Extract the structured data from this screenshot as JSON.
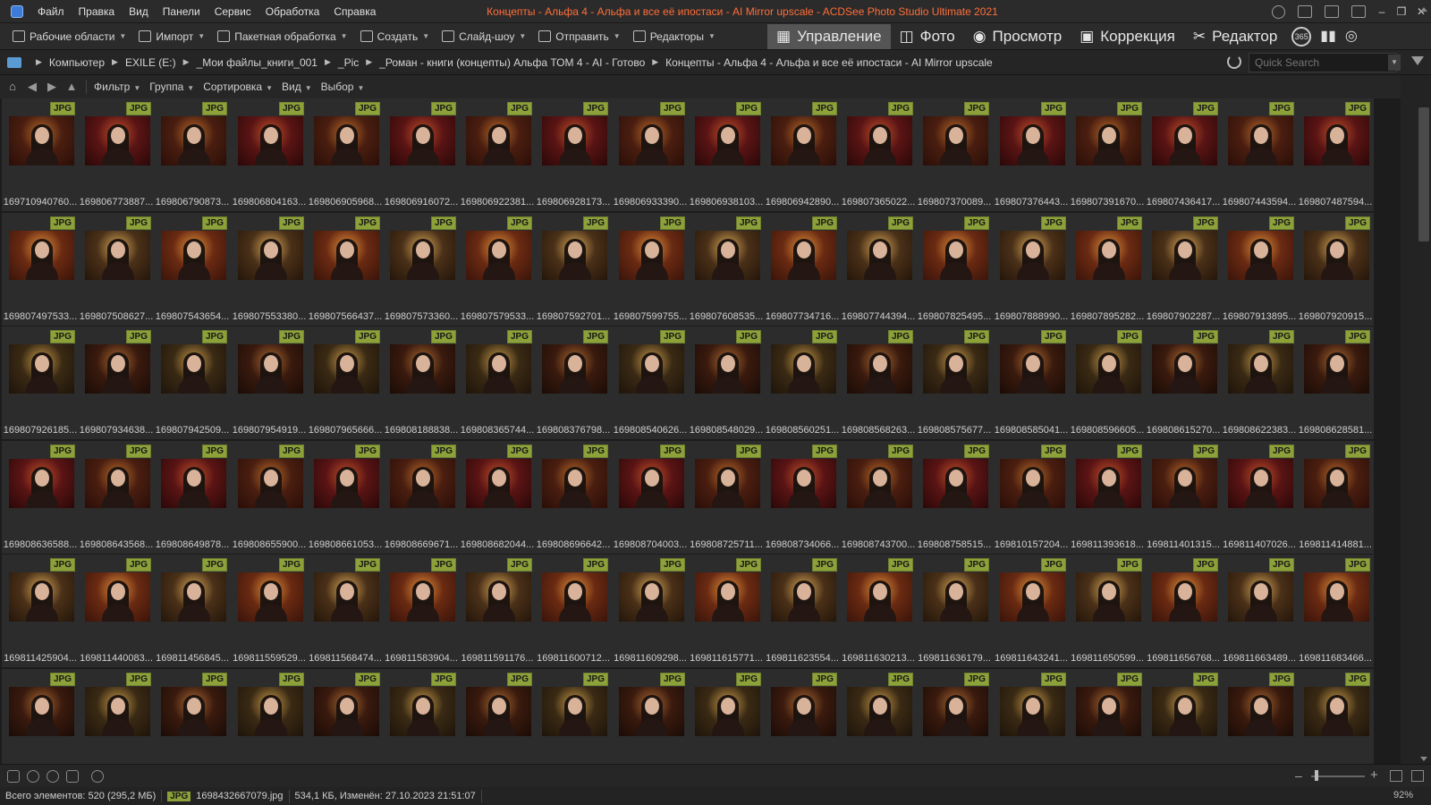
{
  "window": {
    "title": "Концепты - Альфа 4 - Альфа и все её ипостаси - AI Mirror upscale - ACDSee Photo Studio Ultimate 2021",
    "menu": [
      "Файл",
      "Правка",
      "Вид",
      "Панели",
      "Сервис",
      "Обработка",
      "Справка"
    ]
  },
  "toolbar": {
    "items": [
      "Рабочие области",
      "Импорт",
      "Пакетная обработка",
      "Создать",
      "Слайд-шоу",
      "Отправить",
      "Редакторы"
    ],
    "modes": [
      "Управление",
      "Фото",
      "Просмотр",
      "Коррекция",
      "Редактор"
    ],
    "active_mode": "Управление",
    "mode_365": "365"
  },
  "addressbar": {
    "crumbs": [
      "Компьютер",
      "EXILE (E:)",
      "_Мои файлы_книги_001",
      "_Pic",
      "_Роман - книги (концепты) Альфа ТОМ 4 - AI - Готово",
      "Концепты - Альфа 4 - Альфа и все её ипостаси - AI Mirror upscale"
    ],
    "search_placeholder": "Quick Search"
  },
  "filterbar": {
    "items": [
      "Фильтр",
      "Группа",
      "Сортировка",
      "Вид",
      "Выбор"
    ]
  },
  "grid": {
    "badge": "JPG",
    "rows": [
      [
        "169710940760...",
        "169806773887...",
        "169806790873...",
        "169806804163...",
        "169806905968...",
        "169806916072...",
        "169806922381...",
        "169806928173...",
        "169806933390...",
        "169806938103...",
        "169806942890...",
        "169807365022...",
        "169807370089...",
        "169807376443...",
        "169807391670...",
        "169807436417...",
        "169807443594...",
        "169807487594..."
      ],
      [
        "169807497533...",
        "169807508627...",
        "169807543654...",
        "169807553380...",
        "169807566437...",
        "169807573360...",
        "169807579533...",
        "169807592701...",
        "169807599755...",
        "169807608535...",
        "169807734716...",
        "169807744394...",
        "169807825495...",
        "169807888990...",
        "169807895282...",
        "169807902287...",
        "169807913895...",
        "169807920915..."
      ],
      [
        "169807926185...",
        "169807934638...",
        "169807942509...",
        "169807954919...",
        "169807965666...",
        "169808188838...",
        "169808365744...",
        "169808376798...",
        "169808540626...",
        "169808548029...",
        "169808560251...",
        "169808568263...",
        "169808575677...",
        "169808585041...",
        "169808596605...",
        "169808615270...",
        "169808622383...",
        "169808628581..."
      ],
      [
        "169808636588...",
        "169808643568...",
        "169808649878...",
        "169808655900...",
        "169808661053...",
        "169808669671...",
        "169808682044...",
        "169808696642...",
        "169808704003...",
        "169808725711...",
        "169808734066...",
        "169808743700...",
        "169808758515...",
        "169810157204...",
        "169811393618...",
        "169811401315...",
        "169811407026...",
        "169811414881..."
      ],
      [
        "169811425904...",
        "169811440083...",
        "169811456845...",
        "169811559529...",
        "169811568474...",
        "169811583904...",
        "169811591176...",
        "169811600712...",
        "169811609298...",
        "169811615771...",
        "169811623554...",
        "169811630213...",
        "169811636179...",
        "169811643241...",
        "169811650599...",
        "169811656768...",
        "169811663489...",
        "169811683466..."
      ],
      [
        "",
        "",
        "",
        "",
        "",
        "",
        "",
        "",
        "",
        "",
        "",
        "",
        "",
        "",
        "",
        "",
        "",
        ""
      ]
    ]
  },
  "status": {
    "total": "Всего элементов: 520  (295,2 МБ)",
    "badge": "JPG",
    "selected_file": "1698432667079.jpg",
    "file_info": "534,1 КБ, Изменён: 27.10.2023 21:51:07",
    "zoom": "92%"
  },
  "colors": {
    "accent_title": "#ff6e3a",
    "badge": "#8da13a",
    "background": "#1c1c1c"
  }
}
